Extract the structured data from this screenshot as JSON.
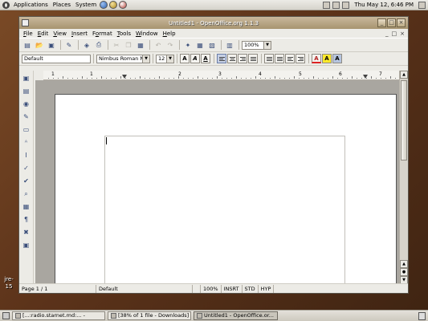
{
  "top_panel": {
    "menus": [
      "Applications",
      "Places",
      "System"
    ],
    "clock": "Thu May 12,  6:46 PM"
  },
  "desktop_icon_label": "jre-\n15",
  "window": {
    "title": "Untitled1 - OpenOffice.org 1.1.3",
    "controls": {
      "minimize": "_",
      "maximize": "□",
      "close": "×"
    }
  },
  "menubar": {
    "items": [
      {
        "label": "File",
        "accel": "F"
      },
      {
        "label": "Edit",
        "accel": "E"
      },
      {
        "label": "View",
        "accel": "V"
      },
      {
        "label": "Insert",
        "accel": "I"
      },
      {
        "label": "Format",
        "accel": "o"
      },
      {
        "label": "Tools",
        "accel": "T"
      },
      {
        "label": "Window",
        "accel": "W"
      },
      {
        "label": "Help",
        "accel": "H"
      }
    ],
    "doc_controls": [
      "_",
      "□",
      "×"
    ]
  },
  "toolbar": {
    "zoom_value": "100%"
  },
  "format_bar": {
    "paragraph_style": "Default",
    "font_name": "Nimbus Roman N",
    "font_size": "12",
    "bold": "A",
    "italic": "A",
    "underline": "A",
    "font_color": "A",
    "highlight": "A",
    "background": "A"
  },
  "ruler": {
    "numbers": [
      "1",
      "1",
      "2",
      "3",
      "4",
      "5",
      "6",
      "7"
    ]
  },
  "statusbar": {
    "page": "Page 1 / 1",
    "style": "Default",
    "zoom": "100%",
    "insert_mode": "INSRT",
    "selection_mode": "STD",
    "hyperlink_mode": "HYP"
  },
  "taskbar": {
    "tasks": [
      {
        "label": "[...:radio.starnet.md:... -"
      },
      {
        "label": "[38% of 1 file - Downloads]"
      },
      {
        "label": "Untitled1 - OpenOffice.or..."
      }
    ]
  },
  "colors": {
    "titlebar": "#a7946f",
    "desktop": "#5c331a",
    "font_color_red": "#d22222",
    "highlight_yellow": "#ffe92b"
  }
}
